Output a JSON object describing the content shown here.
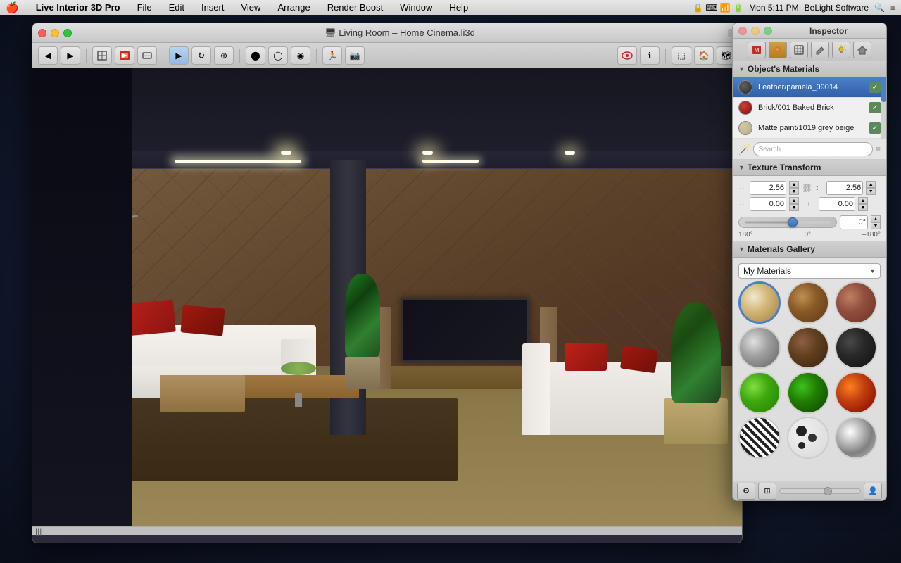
{
  "menubar": {
    "apple": "🍎",
    "items": [
      "Live Interior 3D Pro",
      "File",
      "Edit",
      "Insert",
      "View",
      "Arrange",
      "Render Boost",
      "Window",
      "Help"
    ],
    "right": {
      "clock": "Mon 5:11 PM",
      "brand": "BeLight Software"
    }
  },
  "viewport": {
    "title": "Living Room – Home Cinema.li3d",
    "scrollbar_label": "|||"
  },
  "inspector": {
    "title": "Inspector",
    "toolbar_buttons": [
      "material-icon",
      "sphere-icon",
      "pencil-icon",
      "texture-icon",
      "light-icon",
      "home-icon"
    ],
    "objects_materials_label": "Object's Materials",
    "materials": [
      {
        "name": "Leather/pamela_09014",
        "color": "#4a4a4a",
        "selected": true
      },
      {
        "name": "Brick/001 Baked Brick",
        "color": "#c03020",
        "selected": false
      },
      {
        "name": "Matte paint/1019 grey beige",
        "color": "#d4c8a8",
        "selected": false
      }
    ],
    "wand_icon": "🪄",
    "texture_transform_label": "Texture Transform",
    "transform": {
      "width_value": "2.56",
      "height_value": "2.56",
      "offset_x": "0.00",
      "offset_y": "0.00",
      "rotation_value": "0°",
      "rotation_min": "180°",
      "rotation_mid": "0°",
      "rotation_max": "–180°"
    },
    "materials_gallery_label": "Materials Gallery",
    "gallery_dropdown": "My Materials",
    "gallery_items": [
      {
        "style": "mat-light-wood",
        "selected": true
      },
      {
        "style": "mat-dark-wood",
        "selected": false
      },
      {
        "style": "mat-brick-brown",
        "selected": false
      },
      {
        "style": "mat-metal-gray",
        "selected": false
      },
      {
        "style": "mat-dark-brown",
        "selected": false
      },
      {
        "style": "mat-dark-black",
        "selected": false
      },
      {
        "style": "mat-green-bright",
        "selected": false
      },
      {
        "style": "mat-green-dark",
        "selected": false
      },
      {
        "style": "mat-fire",
        "selected": false
      },
      {
        "style": "mat-zebra",
        "selected": false
      },
      {
        "style": "mat-spots",
        "selected": false
      },
      {
        "style": "mat-chrome",
        "selected": false
      }
    ]
  },
  "colors": {
    "accent_blue": "#4a80c8",
    "selected_bg": "#3060a8",
    "toolbar_bg": "#d0d0d0"
  }
}
